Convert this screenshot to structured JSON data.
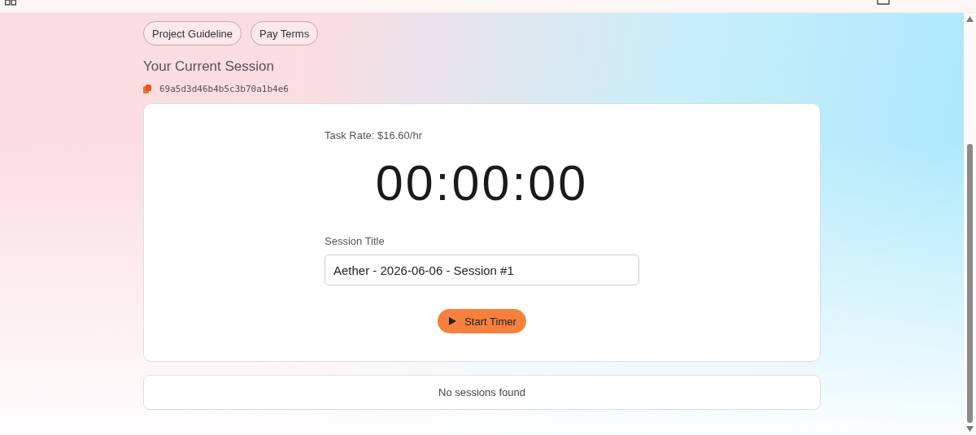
{
  "links": [
    {
      "label": "Project Guideline"
    },
    {
      "label": "Pay Terms"
    }
  ],
  "session": {
    "heading": "Your Current Session",
    "id": "69a5d3d46b4b5c3b70a1b4e6"
  },
  "timer": {
    "rate": "Task Rate: $16.60/hr",
    "clock": "00:00:00",
    "field_label": "Session Title",
    "field_value": "Aether - 2026-06-06 - Session #1",
    "button": "Start Timer"
  },
  "sessions": {
    "empty_message": "No sessions found"
  }
}
